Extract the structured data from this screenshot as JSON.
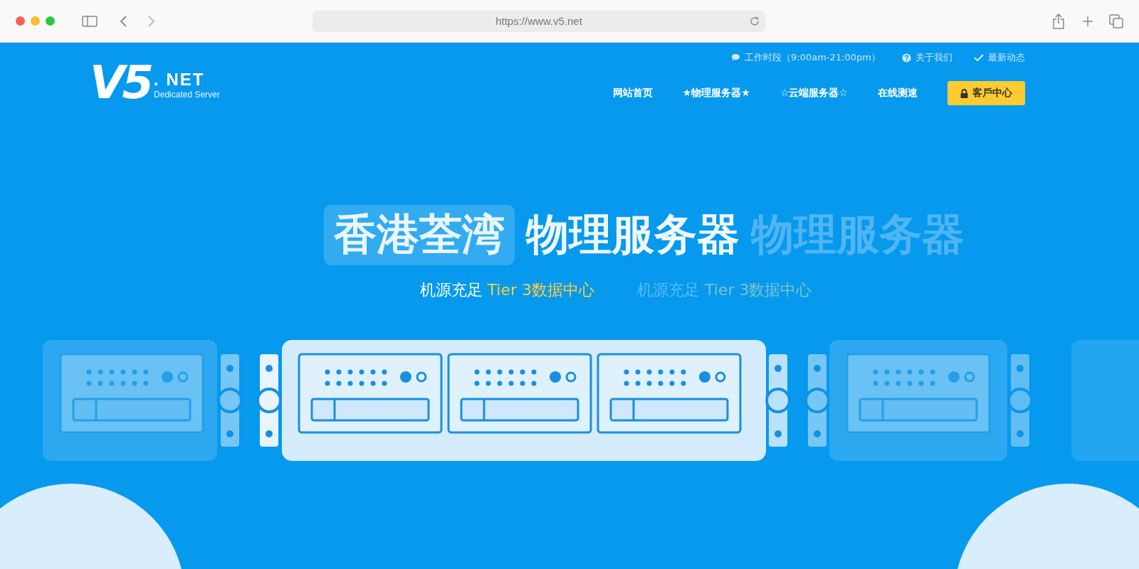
{
  "browser": {
    "url": "https://www.v5.net"
  },
  "logo": {
    "mark": "V5",
    "name": ". NET",
    "tagline": "Dedicated Server"
  },
  "topbar": [
    {
      "kind": "hours",
      "text": "工作时段（9:00am-21:00pm）"
    },
    {
      "kind": "about",
      "text": "关于我们"
    },
    {
      "kind": "news",
      "text": "最新动态"
    }
  ],
  "nav": [
    {
      "kind": "link",
      "label": "网站首页"
    },
    {
      "kind": "link",
      "label": "★物理服务器★"
    },
    {
      "kind": "link",
      "label": "☆云端服务器☆"
    },
    {
      "kind": "link",
      "label": "在线测速"
    },
    {
      "kind": "button",
      "label": "客戶中心"
    }
  ],
  "hero": {
    "highlight": "香港荃湾",
    "title": "物理服务器",
    "ghost_title": "物理服务器",
    "subtitle": {
      "lead": "机源充足",
      "accent": "Tier 3数据中心"
    },
    "ghost_subtitle": {
      "lead": "机源充足",
      "accent": "Tier 3数据中心"
    }
  }
}
